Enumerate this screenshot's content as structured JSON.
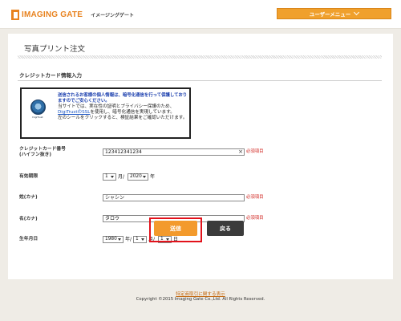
{
  "header": {
    "logo_text": "IMAGING GATE",
    "logo_sub": "イメージングゲート",
    "user_menu_label": "ユーザーメニュー"
  },
  "page": {
    "title": "写真プリント注文",
    "section_title": "クレジットカード情報入力"
  },
  "notice": {
    "seal_caption": "DigiTrust",
    "line1": "送信されるお客様の個人情報は、暗号化通信を行って保護しておりますのでご安心ください。",
    "line2_pre": "当サイトでは、実在性の証明とプライバシー保護のため、",
    "link": "DigiTrustのSSL",
    "line2_post": "を使用し、暗号化通信を実現しています。",
    "line3": "左のシールをクリックすると、検証結果をご確認いただけます。"
  },
  "form": {
    "card_number_label_1": "クレジットカード番号",
    "card_number_label_2": "(ハイフン抜き)",
    "card_number_value": "123412341234",
    "required": "必須項目",
    "expiry_label": "有効期限",
    "expiry_month": "1",
    "month_unit": "月/",
    "expiry_year": "2020",
    "year_unit": "年",
    "sei_label": "姓(カナ)",
    "sei_value": "シャシン",
    "mei_label": "名(カナ)",
    "mei_value": "タロウ",
    "birth_label": "生年月日",
    "birth_year": "1980",
    "birth_year_unit": "年/",
    "birth_month": "1",
    "birth_month_unit": "月/",
    "birth_day": "1",
    "birth_day_unit": "日"
  },
  "buttons": {
    "send": "送信",
    "back": "戻る"
  },
  "footer": {
    "link": "特定商取引に関する表示",
    "copyright": "Copyright ©2015 Imaging Gate Co.,Ltd. All Rights Reserved."
  },
  "colors": {
    "accent": "#f39a2c",
    "required": "#d0211c",
    "highlight_frame": "#e2121b"
  }
}
